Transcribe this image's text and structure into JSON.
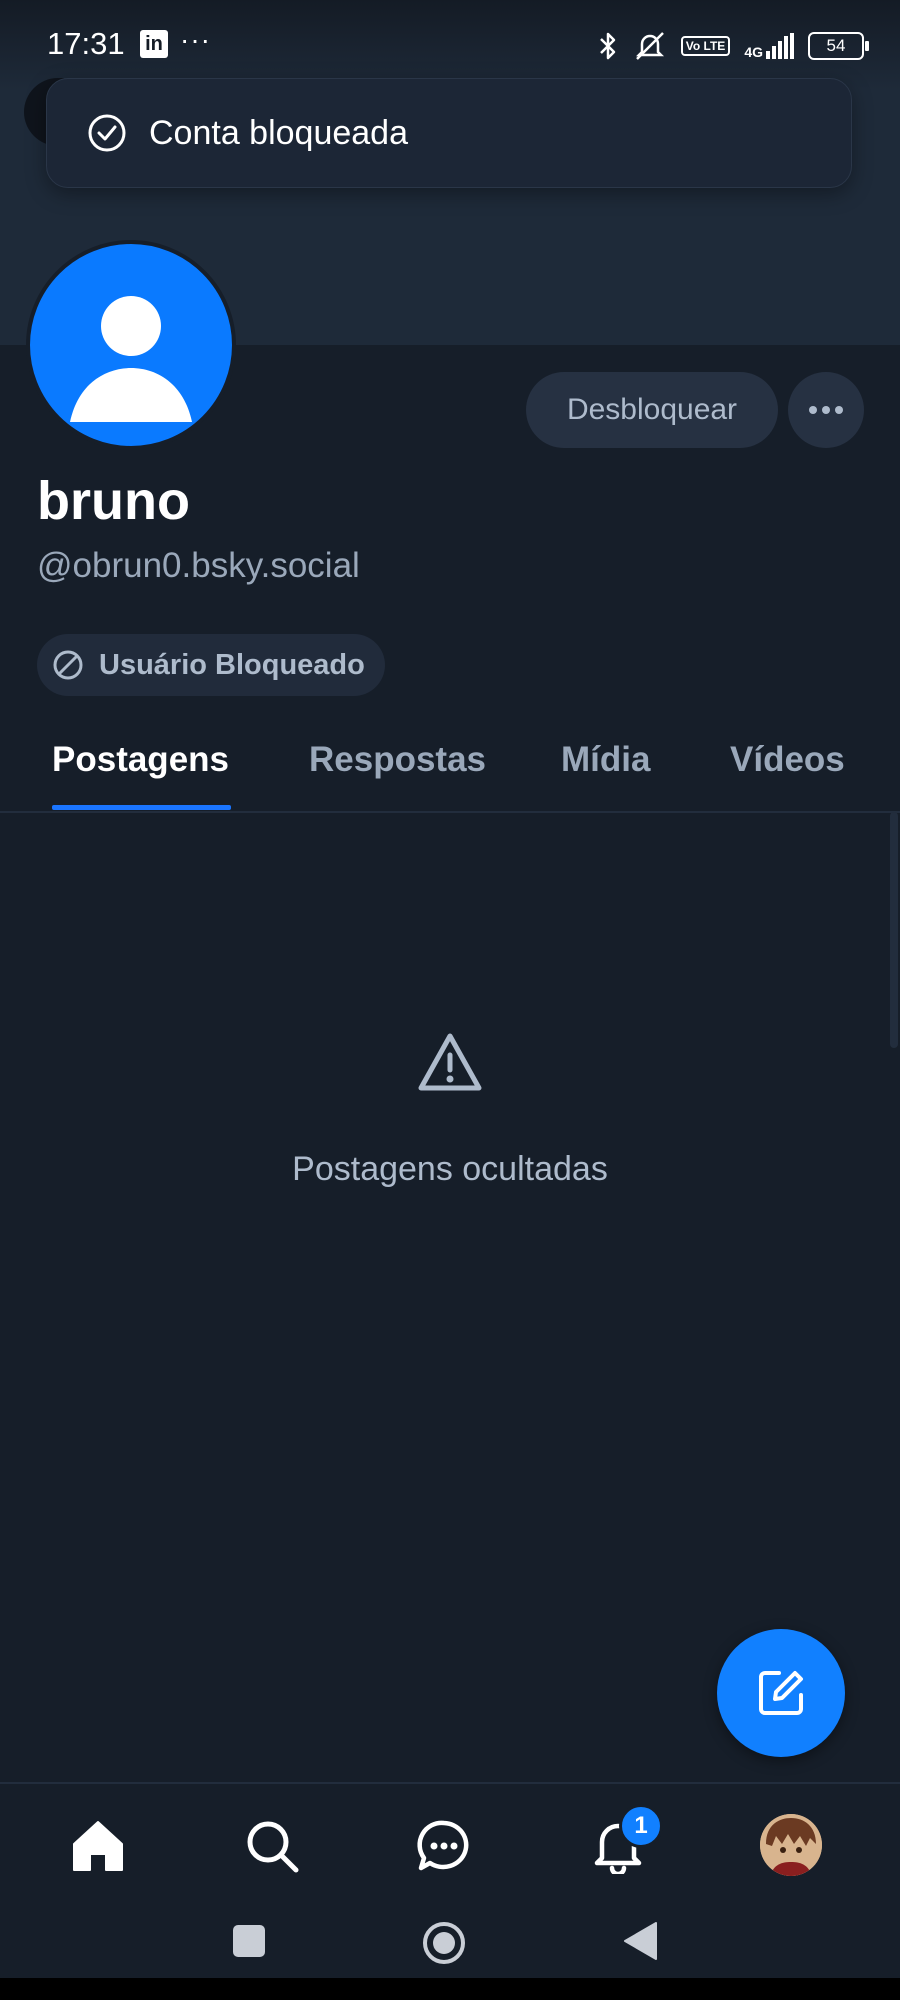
{
  "status_bar": {
    "time": "17:31",
    "linkedin_label": "in",
    "more": "···",
    "volte": "Vo LTE",
    "network": "4G",
    "battery": "54"
  },
  "toast": {
    "message": "Conta bloqueada",
    "icon": "check-circle-icon"
  },
  "profile": {
    "display_name": "bruno",
    "handle": "@obrun0.bsky.social",
    "unblock_label": "Desbloquear",
    "blocked_badge": "Usuário Bloqueado"
  },
  "tabs": [
    {
      "label": "Postagens",
      "active": true
    },
    {
      "label": "Respostas",
      "active": false
    },
    {
      "label": "Mídia",
      "active": false
    },
    {
      "label": "Vídeos",
      "active": false
    }
  ],
  "empty_state": {
    "message": "Postagens ocultadas",
    "icon": "warning-triangle-icon"
  },
  "bottom_nav": {
    "items": [
      "home-icon",
      "search-icon",
      "chat-icon",
      "bell-icon",
      "profile-avatar"
    ],
    "notification_count": "1"
  },
  "colors": {
    "background": "#161e29",
    "banner": "#1e2a39",
    "accent": "#1180ff",
    "avatar": "#0a7aff"
  }
}
